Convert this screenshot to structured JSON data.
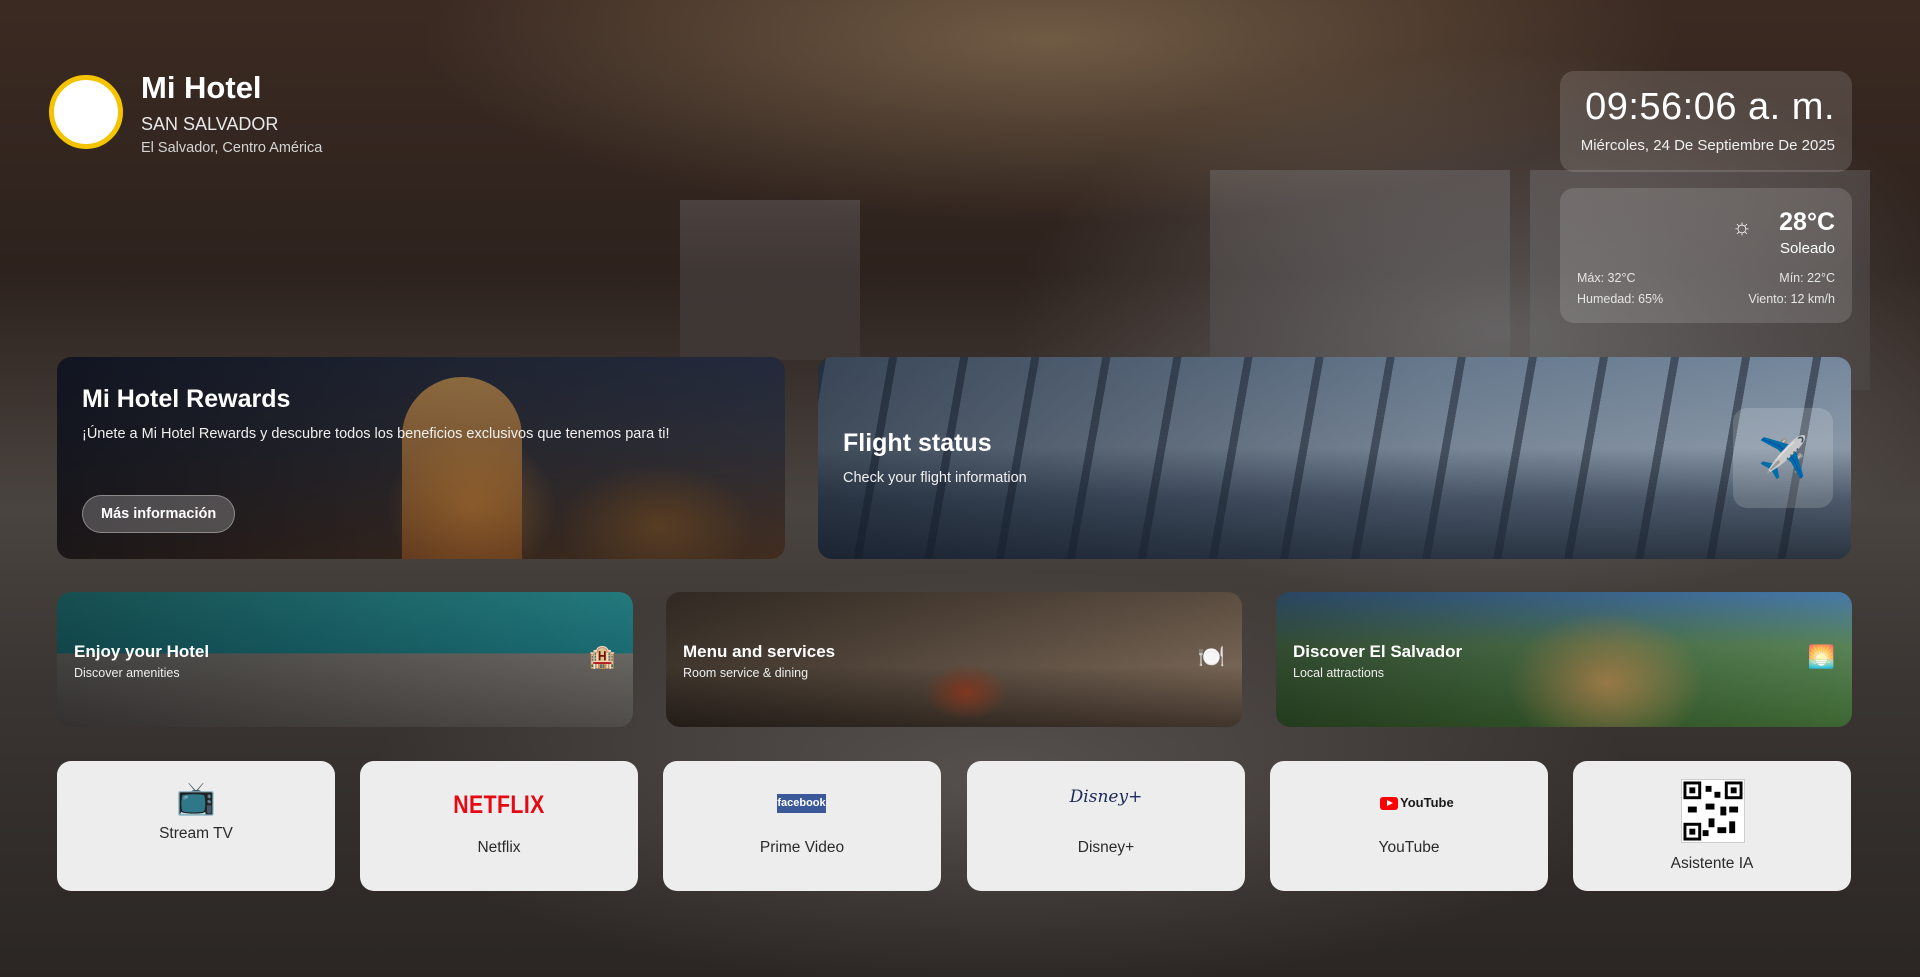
{
  "header": {
    "hotel_name": "Mi Hotel",
    "city": "SAN SALVADOR",
    "country": "El Salvador, Centro América"
  },
  "clock": {
    "time": "09:56:06 a. m.",
    "date": "Miércoles, 24 De Septiembre De 2025"
  },
  "weather": {
    "temp": "28°C",
    "condition": "Soleado",
    "max": "Máx: 32°C",
    "min": "Mín: 22°C",
    "humidity": "Humedad: 65%",
    "wind": "Viento: 12 km/h",
    "icon": "sun-icon"
  },
  "rewards": {
    "title": "Mi Hotel Rewards",
    "description": "¡Únete a Mi Hotel Rewards y descubre todos los beneficios exclusivos que tenemos para ti!",
    "button_label": "Más información"
  },
  "flight": {
    "title": "Flight status",
    "subtitle": "Check your flight information",
    "icon": "airplane-icon"
  },
  "tiles": [
    {
      "title": "Enjoy your Hotel",
      "subtitle": "Discover amenities",
      "icon": "hotel-icon"
    },
    {
      "title": "Menu and services",
      "subtitle": "Room service & dining",
      "icon": "plate-icon"
    },
    {
      "title": "Discover El Salvador",
      "subtitle": "Local attractions",
      "icon": "sunset-icon"
    }
  ],
  "apps": [
    {
      "label": "Stream TV",
      "icon": "tv-icon"
    },
    {
      "label": "Netflix",
      "logo_text": "NETFLIX",
      "accent": "#e50914"
    },
    {
      "label": "Prime Video",
      "logo_text": "facebook",
      "accent": "#3b5998"
    },
    {
      "label": "Disney+",
      "logo_text": "Disney+"
    },
    {
      "label": "YouTube",
      "logo_text": "YouTube",
      "accent": "#ff0000"
    },
    {
      "label": "Asistente IA",
      "icon": "qr-code-icon"
    }
  ]
}
